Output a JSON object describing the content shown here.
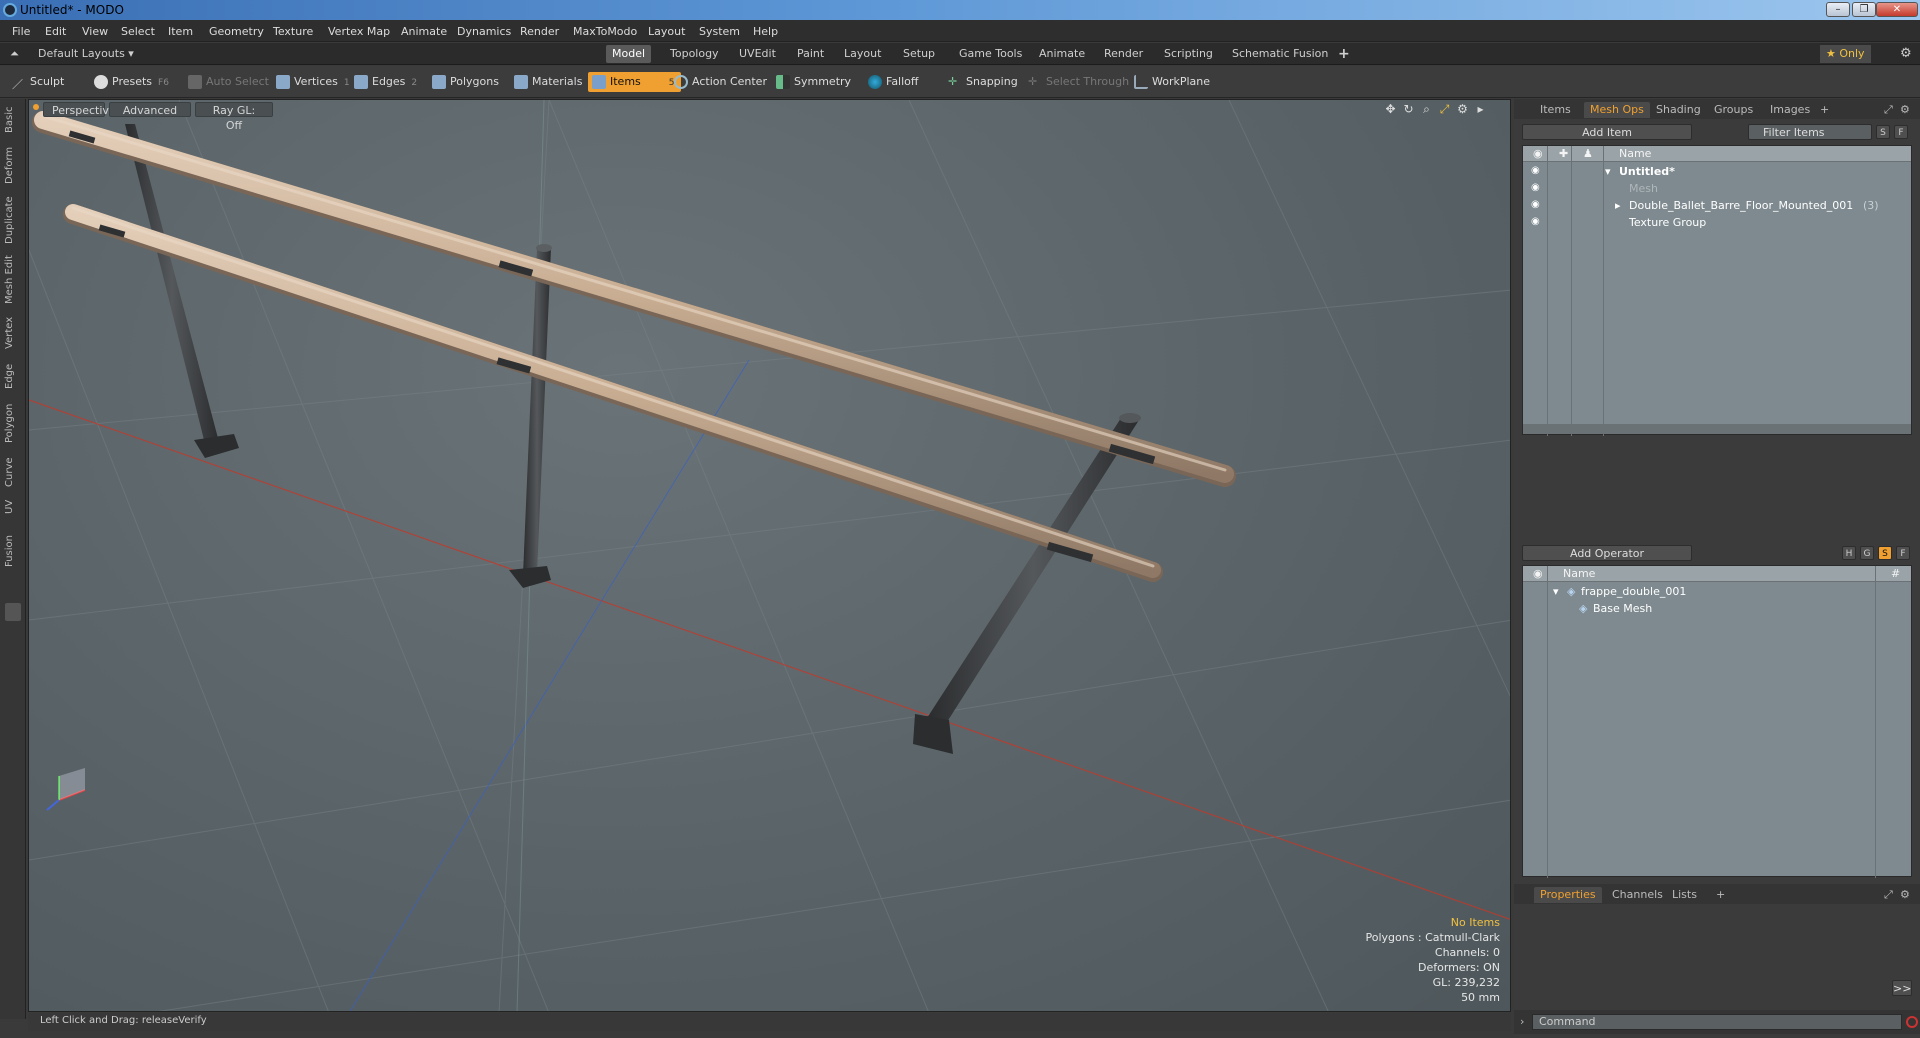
{
  "window": {
    "title": "Untitled* - MODO",
    "minimize": "–",
    "maximize": "❐",
    "close": "✕"
  },
  "menu": [
    "File",
    "Edit",
    "View",
    "Select",
    "Item",
    "Geometry",
    "Texture",
    "Vertex Map",
    "Animate",
    "Dynamics",
    "Render",
    "MaxToModo",
    "Layout",
    "System",
    "Help"
  ],
  "layouts": {
    "default_layouts": "Default Layouts ▾",
    "tabs": [
      "Model",
      "Topology",
      "UVEdit",
      "Paint",
      "Layout",
      "Setup",
      "Game Tools",
      "Animate",
      "Render",
      "Scripting",
      "Schematic Fusion"
    ],
    "active_tab": "Model",
    "add": "+",
    "only": "★ Only"
  },
  "toolbar": {
    "sculpt": "Sculpt",
    "presets": "Presets",
    "presets_key": "F6",
    "auto_select": "Auto Select",
    "vertices": "Vertices",
    "vertices_key": "1",
    "edges": "Edges",
    "edges_key": "2",
    "polygons": "Polygons",
    "materials": "Materials",
    "items": "Items",
    "items_key": "5",
    "action_center": "Action Center",
    "symmetry": "Symmetry",
    "falloff": "Falloff",
    "snapping": "Snapping",
    "select_through": "Select Through",
    "workplane": "WorkPlane"
  },
  "left_tabs": [
    "Basic",
    "Deform",
    "Duplicate",
    "Mesh Edit",
    "Vertex",
    "Edge",
    "Polygon",
    "Curve",
    "UV",
    "Fusion"
  ],
  "viewport": {
    "perspective": "Perspective",
    "advanced": "Advanced",
    "raygl": "Ray GL: Off",
    "info": {
      "no_items": "No Items",
      "polygons": "Polygons : Catmull-Clark",
      "channels": "Channels: 0",
      "deformers": "Deformers: ON",
      "gl": "GL: 239,232",
      "focal": "50 mm"
    }
  },
  "status": {
    "text": "Left Click and Drag:   releaseVerify"
  },
  "items_panel": {
    "tabs": [
      "Items",
      "Mesh Ops",
      "Shading",
      "Groups",
      "Images",
      "+"
    ],
    "active_tab": "Mesh Ops",
    "add_item": "Add Item",
    "filter": "Filter Items",
    "s": "S",
    "f": "F",
    "col_name": "Name",
    "tree": [
      {
        "label": "Untitled*",
        "bold": true
      },
      {
        "label": "Mesh",
        "dim": true
      },
      {
        "label": "Double_Ballet_Barre_Floor_Mounted_001",
        "count": "(3)"
      },
      {
        "label": "Texture Group"
      }
    ]
  },
  "ops_panel": {
    "add_operator": "Add Operator",
    "h": "H",
    "g": "G",
    "s": "S",
    "f": "F",
    "col_name": "Name",
    "col_hash": "#",
    "tree": [
      {
        "label": "frappe_double_001"
      },
      {
        "label": "Base Mesh"
      }
    ]
  },
  "props_panel": {
    "tabs": [
      "Properties",
      "Channels",
      "Lists",
      "+"
    ],
    "active_tab": "Properties",
    "expand": ">>"
  },
  "command": {
    "placeholder": "Command"
  },
  "colors": {
    "accent": "#f0a030",
    "bar_wood": "#c8ad92",
    "post_metal": "#3c3e40"
  }
}
